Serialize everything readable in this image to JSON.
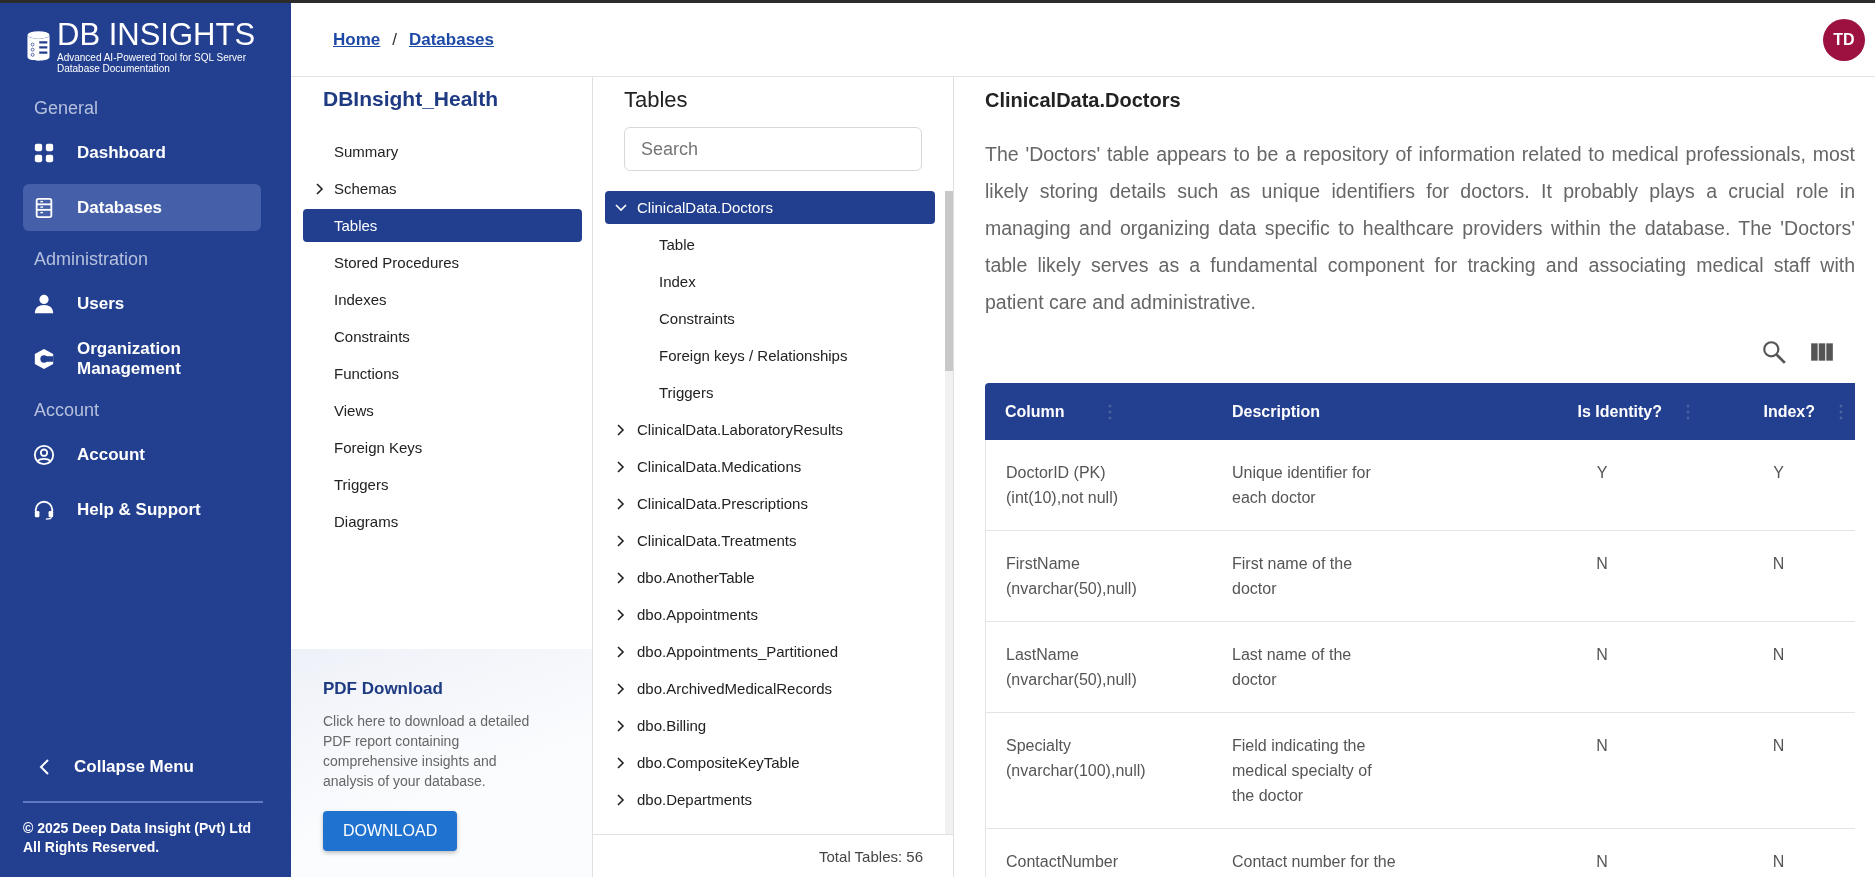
{
  "logo": {
    "title": "DB INSIGHTS",
    "subtitle": "Advanced AI-Powered Tool for SQL Server Database Documentation"
  },
  "sidebar": {
    "sections": [
      {
        "label": "General",
        "items": [
          {
            "label": "Dashboard",
            "kind": "grid",
            "selected": false
          },
          {
            "label": "Databases",
            "kind": "list",
            "selected": true
          }
        ]
      },
      {
        "label": "Administration",
        "items": [
          {
            "label": "Users",
            "kind": "user",
            "selected": false
          },
          {
            "label": "Organization Management",
            "kind": "hex",
            "selected": false
          }
        ]
      },
      {
        "label": "Account",
        "items": [
          {
            "label": "Account",
            "kind": "account",
            "selected": false
          },
          {
            "label": "Help & Support",
            "kind": "headset",
            "selected": false
          }
        ]
      }
    ],
    "collapse": "Collapse Menu",
    "copyright": "© 2025 Deep Data Insight (Pvt) Ltd\nAll Rights Reserved."
  },
  "breadcrumb": {
    "items": [
      "Home",
      "Databases"
    ],
    "separator": "/"
  },
  "avatar": "TD",
  "nav": {
    "title": "DBInsight_Health",
    "items": [
      {
        "label": "Summary",
        "kind": "link",
        "selected": false
      },
      {
        "label": "Schemas",
        "kind": "group",
        "selected": false
      },
      {
        "label": "Tables",
        "kind": "link",
        "selected": true
      },
      {
        "label": "Stored Procedures",
        "kind": "link",
        "selected": false
      },
      {
        "label": "Indexes",
        "kind": "link",
        "selected": false
      },
      {
        "label": "Constraints",
        "kind": "link",
        "selected": false
      },
      {
        "label": "Functions",
        "kind": "link",
        "selected": false
      },
      {
        "label": "Views",
        "kind": "link",
        "selected": false
      },
      {
        "label": "Foreign Keys",
        "kind": "link",
        "selected": false
      },
      {
        "label": "Triggers",
        "kind": "link",
        "selected": false
      },
      {
        "label": "Diagrams",
        "kind": "link",
        "selected": false
      }
    ],
    "pdf": {
      "title": "PDF Download",
      "text": "Click here to download a detailed PDF report containing comprehensive insights and analysis of your database.",
      "button": "DOWNLOAD"
    }
  },
  "tables": {
    "title": "Tables",
    "search": {
      "placeholder": "Search"
    },
    "items": [
      {
        "name": "ClinicalData.Doctors",
        "selected": true,
        "expanded": true,
        "children": [
          {
            "label": "Table"
          },
          {
            "label": "Index"
          },
          {
            "label": "Constraints"
          },
          {
            "label": "Foreign keys / Relationships"
          },
          {
            "label": "Triggers"
          }
        ]
      },
      {
        "name": "ClinicalData.LaboratoryResults",
        "selected": false,
        "expanded": false
      },
      {
        "name": "ClinicalData.Medications",
        "selected": false,
        "expanded": false
      },
      {
        "name": "ClinicalData.Prescriptions",
        "selected": false,
        "expanded": false
      },
      {
        "name": "ClinicalData.Treatments",
        "selected": false,
        "expanded": false
      },
      {
        "name": "dbo.AnotherTable",
        "selected": false,
        "expanded": false
      },
      {
        "name": "dbo.Appointments",
        "selected": false,
        "expanded": false
      },
      {
        "name": "dbo.Appointments_Partitioned",
        "selected": false,
        "expanded": false
      },
      {
        "name": "dbo.ArchivedMedicalRecords",
        "selected": false,
        "expanded": false
      },
      {
        "name": "dbo.Billing",
        "selected": false,
        "expanded": false
      },
      {
        "name": "dbo.CompositeKeyTable",
        "selected": false,
        "expanded": false
      },
      {
        "name": "dbo.Departments",
        "selected": false,
        "expanded": false
      }
    ],
    "total": "Total Tables: 56"
  },
  "detail": {
    "title": "ClinicalData.Doctors",
    "description": "The 'Doctors' table appears to be a repository of information related to medical professionals, most likely storing details such as unique identifiers for doctors. It probably plays a crucial role in managing and organizing data specific to healthcare providers within the database. The 'Doctors' table likely serves as a fundamental component for tracking and associating medical staff with patient care and administrative.",
    "table": {
      "columns": [
        "Column",
        "Description",
        "Is Identity?",
        "Index?"
      ],
      "rows": [
        [
          "DoctorID (PK)\n(int(10),not null)",
          "Unique identifier for\neach doctor",
          "Y",
          "Y"
        ],
        [
          "FirstName\n(nvarchar(50),null)",
          "First name of the\ndoctor",
          "N",
          "N"
        ],
        [
          "LastName\n(nvarchar(50),null)",
          "Last name of the\ndoctor",
          "N",
          "N"
        ],
        [
          "Specialty\n(nvarchar(100),null)",
          "Field indicating the\nmedical specialty of\nthe doctor",
          "N",
          "N"
        ],
        [
          "ContactNumber",
          "Contact number for the",
          "N",
          "N"
        ]
      ]
    }
  }
}
